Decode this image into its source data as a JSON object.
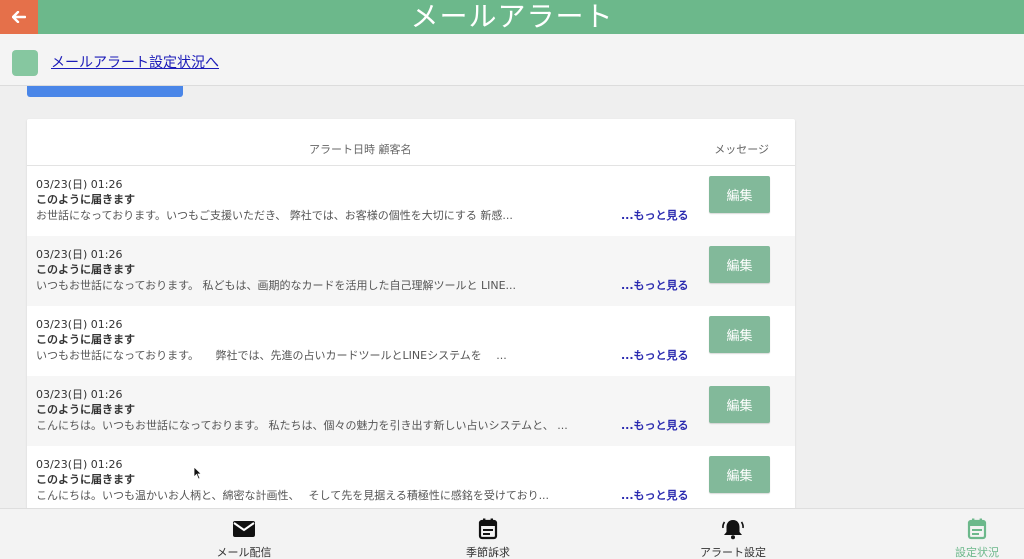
{
  "header": {
    "title": "メールアラート",
    "back_icon": "arrow-left-icon",
    "color": "#6cb88b",
    "back_color": "#e5704a"
  },
  "subbar": {
    "link_label": "メールアラート設定状況へ"
  },
  "table": {
    "col_date_customer": "アラート日時 顧客名",
    "col_message": "メッセージ",
    "rows": [
      {
        "date": "03/23(日) 01:26",
        "subject": "このように届きます",
        "preview": "お世話になっております。いつもご支援いただき、 弊社では、お客様の個性を大切にする 新感...",
        "more": "...もっと見る",
        "edit": "編集"
      },
      {
        "date": "03/23(日) 01:26",
        "subject": "このように届きます",
        "preview": "いつもお世話になっております。 私どもは、画期的なカードを活用した自己理解ツールと LINE...",
        "more": "...もっと見る",
        "edit": "編集"
      },
      {
        "date": "03/23(日) 01:26",
        "subject": "このように届きます",
        "preview": "いつもお世話になっております。　　弊社では、先進の占いカードツールとLINEシステムを　 ...",
        "more": "...もっと見る",
        "edit": "編集"
      },
      {
        "date": "03/23(日) 01:26",
        "subject": "このように届きます",
        "preview": "こんにちは。いつもお世話になっております。 私たちは、個々の魅力を引き出す新しい占いシステムと、 ...",
        "more": "...もっと見る",
        "edit": "編集"
      },
      {
        "date": "03/23(日) 01:26",
        "subject": "このように届きます",
        "preview": "こんにちは。いつも温かいお人柄と、綿密な計画性、　 そして先を見据える積極性に感銘を受けており...",
        "more": "...もっと見る",
        "edit": "編集"
      }
    ]
  },
  "bottom_nav": {
    "items": [
      {
        "label": "メール配信",
        "icon": "mail-icon"
      },
      {
        "label": "季節訴求",
        "icon": "calendar-icon"
      },
      {
        "label": "アラート設定",
        "icon": "bell-icon"
      },
      {
        "label": "設定状況",
        "icon": "calendar-check-icon",
        "active": true
      }
    ],
    "active_color": "#6cb88b"
  }
}
